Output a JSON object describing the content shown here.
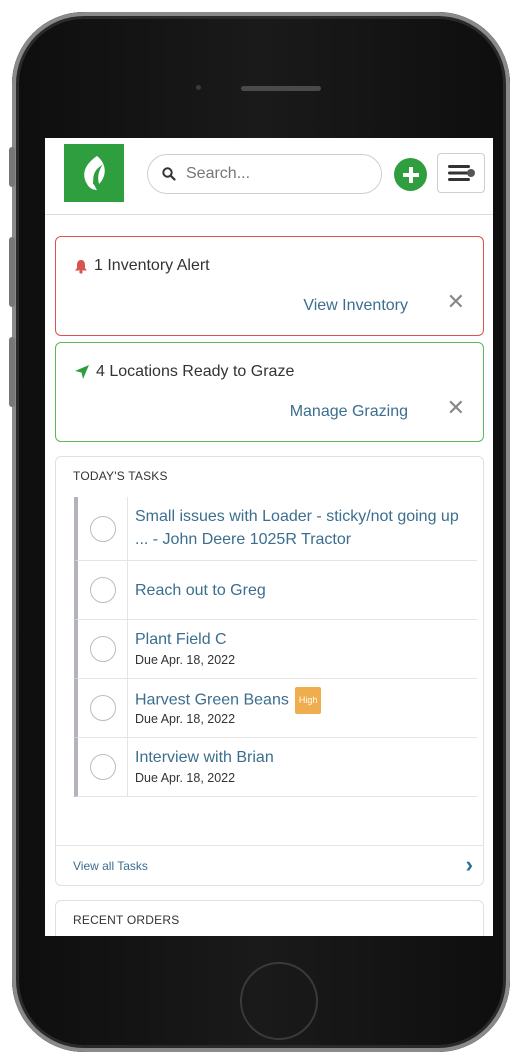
{
  "header": {
    "search_placeholder": "Search...",
    "logo_icon": "leaf-icon",
    "add_icon": "plus-icon",
    "menu_icon": "hamburger-icon"
  },
  "alerts": [
    {
      "icon": "bell-icon",
      "text": "1 Inventory Alert",
      "link": "View Inventory",
      "close": "✕",
      "color": "#d9534f"
    },
    {
      "icon": "location-arrow-icon",
      "text": "4 Locations Ready to Graze",
      "link": "Manage Grazing",
      "close": "✕",
      "color": "#2e9e3f"
    }
  ],
  "tasks": {
    "title": "TODAY'S TASKS",
    "items": [
      {
        "title": "Small issues with Loader - sticky/not going up ... - John Deere 1025R Tractor",
        "due": ""
      },
      {
        "title": "Reach out to Greg",
        "due": ""
      },
      {
        "title": "Plant Field C",
        "due": "Due Apr. 18, 2022"
      },
      {
        "title": "Harvest Green Beans",
        "badge": "High",
        "due": "Due Apr. 18, 2022"
      },
      {
        "title": "Interview with Brian",
        "due": "Due Apr. 18, 2022"
      }
    ],
    "view_all": "View all Tasks",
    "view_all_icon": "chevron-right-icon",
    "chevron": "›"
  },
  "orders": {
    "title": "RECENT ORDERS"
  },
  "colors": {
    "brand_green": "#2e9e3f",
    "link_blue": "#3b6e8f",
    "alert_red": "#d9534f",
    "badge_orange": "#f0ad4e"
  }
}
